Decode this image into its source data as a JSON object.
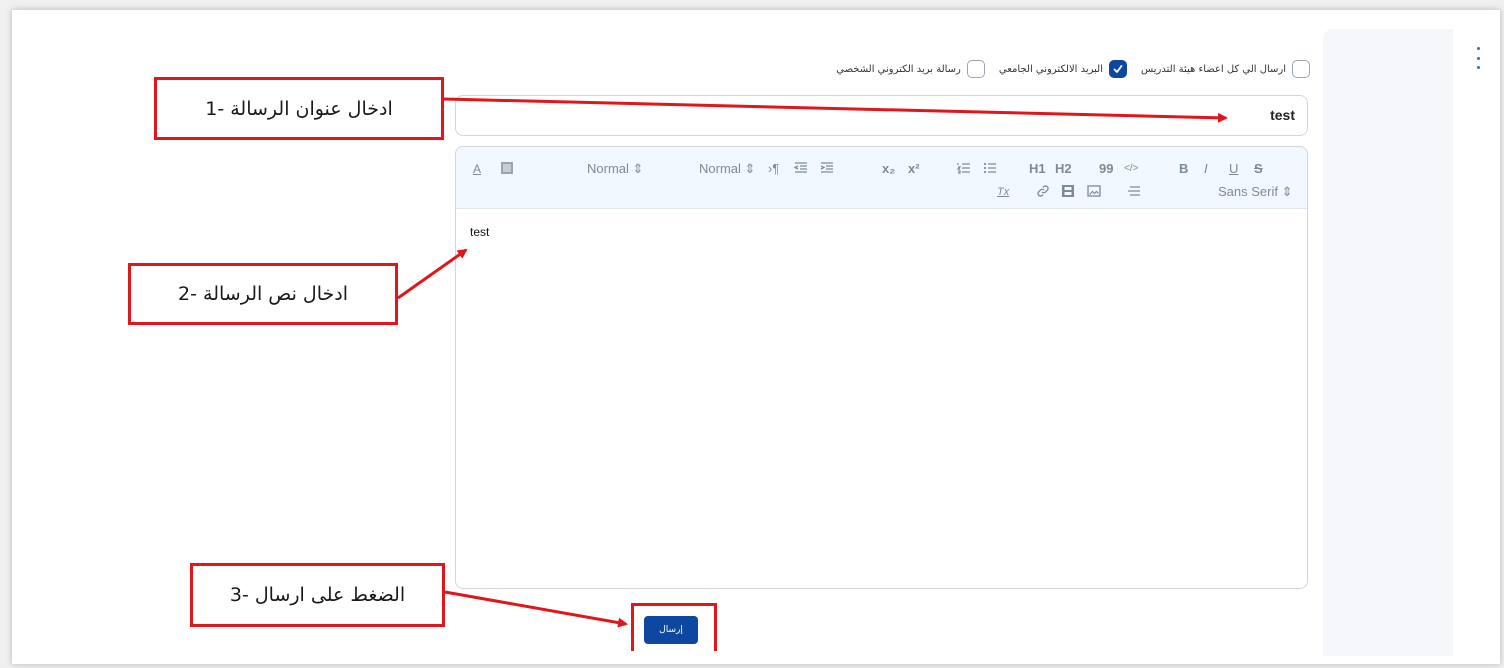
{
  "options": [
    {
      "label": "ارسال الي كل اعضاء هيئة التدريس",
      "checked": false
    },
    {
      "label": "البريد الالكتروني الجامعي",
      "checked": true
    },
    {
      "label": "رسالة بريد الكتروني الشخصي",
      "checked": false
    }
  ],
  "subject": {
    "value": "test"
  },
  "toolbar": {
    "font": "Sans Serif",
    "size_select": "Normal",
    "header_select": "Normal",
    "bold": "B",
    "italic": "I",
    "underline": "U",
    "strike": "S",
    "h1": "H1",
    "h2": "H2",
    "blockquote": "99",
    "code": "</>",
    "subscript": "x₂",
    "superscript": "x²",
    "text_color": "A",
    "clean": "Tx"
  },
  "body": {
    "text": "test"
  },
  "send_button": {
    "label": "إرسال"
  },
  "annotations": {
    "step1": "ادخال عنوان الرسالة -1",
    "step2": "ادخال نص الرسالة -2",
    "step3": "الضغط على ارسال -3"
  },
  "colors": {
    "accent": "#0d47a1",
    "annotation": "#e0161b",
    "toolbar_bg": "#f2f8ff"
  }
}
